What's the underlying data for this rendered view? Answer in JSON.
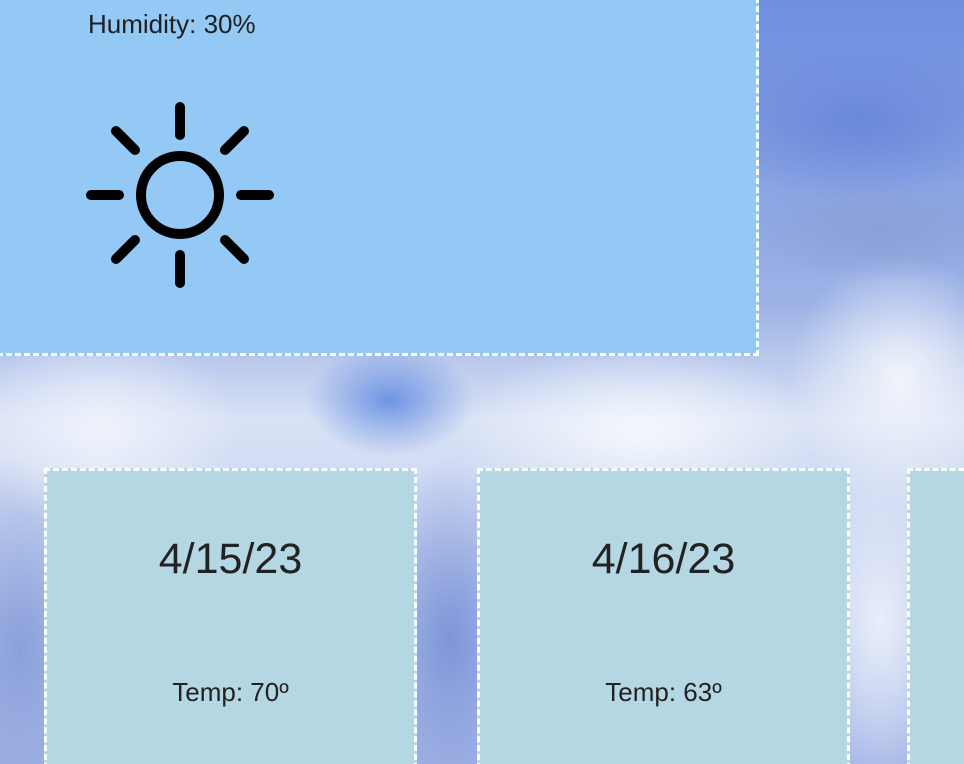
{
  "current": {
    "humidity_label": "Humidity: 30%",
    "icon": "sun-icon"
  },
  "forecast": [
    {
      "date": "4/15/23",
      "temp_label": "Temp: 70º"
    },
    {
      "date": "4/16/23",
      "temp_label": "Temp: 63º"
    },
    {
      "date": "",
      "temp_label": ""
    }
  ],
  "colors": {
    "current_card_bg": "#93c9f4",
    "forecast_card_bg": "#b5d7e3",
    "card_border": "#ffffff"
  }
}
